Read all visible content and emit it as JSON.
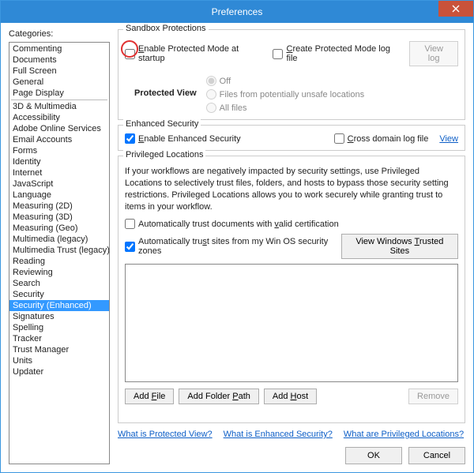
{
  "window": {
    "title": "Preferences"
  },
  "categories": {
    "label": "Categories:",
    "groupA": [
      "Commenting",
      "Documents",
      "Full Screen",
      "General",
      "Page Display"
    ],
    "groupB": [
      "3D & Multimedia",
      "Accessibility",
      "Adobe Online Services",
      "Email Accounts",
      "Forms",
      "Identity",
      "Internet",
      "JavaScript",
      "Language",
      "Measuring (2D)",
      "Measuring (3D)",
      "Measuring (Geo)",
      "Multimedia (legacy)",
      "Multimedia Trust (legacy)",
      "Reading",
      "Reviewing",
      "Search",
      "Security",
      "Security (Enhanced)",
      "Signatures",
      "Spelling",
      "Tracker",
      "Trust Manager",
      "Units",
      "Updater"
    ],
    "selected": "Security (Enhanced)"
  },
  "sandbox": {
    "legend": "Sandbox Protections",
    "enable_protected_label": "Enable Protected Mode at startup",
    "enable_protected_checked": false,
    "create_log_label": "Create Protected Mode log file",
    "create_log_checked": false,
    "view_log_label": "View log",
    "protected_view_label": "Protected View",
    "radios": [
      "Off",
      "Files from potentially unsafe locations",
      "All files"
    ],
    "protected_view_selected": "Off"
  },
  "enhanced": {
    "legend": "Enhanced Security",
    "enable_label": "Enable Enhanced Security",
    "enable_checked": true,
    "cross_log_label": "Cross domain log file",
    "cross_log_checked": false,
    "view_label": "View"
  },
  "privileged": {
    "legend": "Privileged Locations",
    "description": "If your workflows are negatively impacted by security settings, use Privileged Locations to selectively trust files, folders, and hosts to bypass those security setting restrictions. Privileged Locations allows you to work securely while granting trust to items in your workflow.",
    "auto_trust_docs_label": "Automatically trust documents with valid certification",
    "auto_trust_docs_checked": false,
    "auto_trust_sites_label": "Automatically trust sites from my Win OS security zones",
    "auto_trust_sites_checked": true,
    "view_trusted_label": "View Windows Trusted Sites",
    "add_file_label": "Add File",
    "add_folder_label": "Add Folder Path",
    "add_host_label": "Add Host",
    "remove_label": "Remove"
  },
  "help_links": {
    "protected_view": "What is Protected View?",
    "enhanced_security": "What is Enhanced Security?",
    "privileged_locations": "What are Privileged Locations?"
  },
  "footer": {
    "ok": "OK",
    "cancel": "Cancel"
  }
}
